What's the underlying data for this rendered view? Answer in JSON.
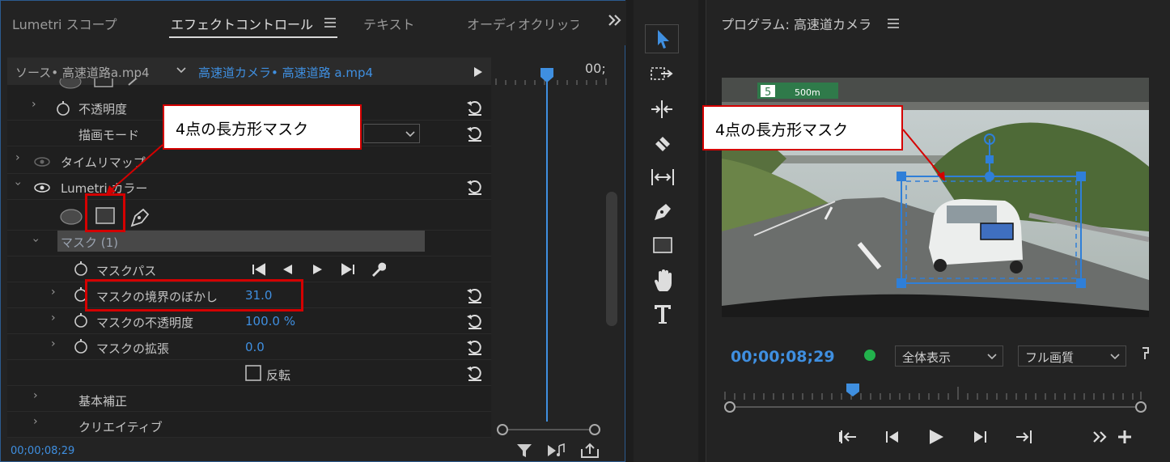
{
  "effect_panel": {
    "tabs": [
      "Lumetri スコープ",
      "エフェクトコントロール",
      "テキスト",
      "オーディオクリップ"
    ],
    "menu_icon": "hamburger-icon",
    "overflow_icon": "double-chevron-right-icon",
    "source_label": "ソース• 高速道路a.mp4",
    "clip_label": "高速道カメラ• 高速道路 a.mp4",
    "timeline_timecode_short": "00;",
    "rows": {
      "opacity": "不透明度",
      "blend_mode": "描画モード",
      "time_remap": "タイムリマップ",
      "lumetri": "Lumetri カラー",
      "mask": "マスク (1)",
      "mask_path": "マスクパス",
      "mask_feather": "マスクの境界のぼかし",
      "mask_feather_value": "31.0",
      "mask_opacity": "マスクの不透明度",
      "mask_opacity_value": "100.0 %",
      "mask_expansion": "マスクの拡張",
      "mask_expansion_value": "0.0",
      "invert": "反転",
      "basic_correction": "基本補正",
      "creative": "クリエイティブ"
    },
    "bottom_timecode": "00;00;08;29",
    "annotation": "4点の長方形マスク"
  },
  "program": {
    "title": "プログラム: 高速道カメラ",
    "timecode": "00;00;08;29",
    "fit_dropdown": "全体表示",
    "quality_dropdown": "フル画質",
    "annotation": "4点の長方形マスク",
    "road_sign_number": "5",
    "road_sign_text": "500m"
  },
  "tools": [
    "selection-tool-icon",
    "track-select-icon",
    "ripple-edit-icon",
    "razor-icon",
    "slip-icon",
    "pen-icon",
    "rectangle-icon",
    "hand-icon",
    "type-icon"
  ],
  "colors": {
    "accent": "#3f8fe0",
    "annotation_red": "#d40000",
    "mask_blue": "#2f7fd8"
  }
}
